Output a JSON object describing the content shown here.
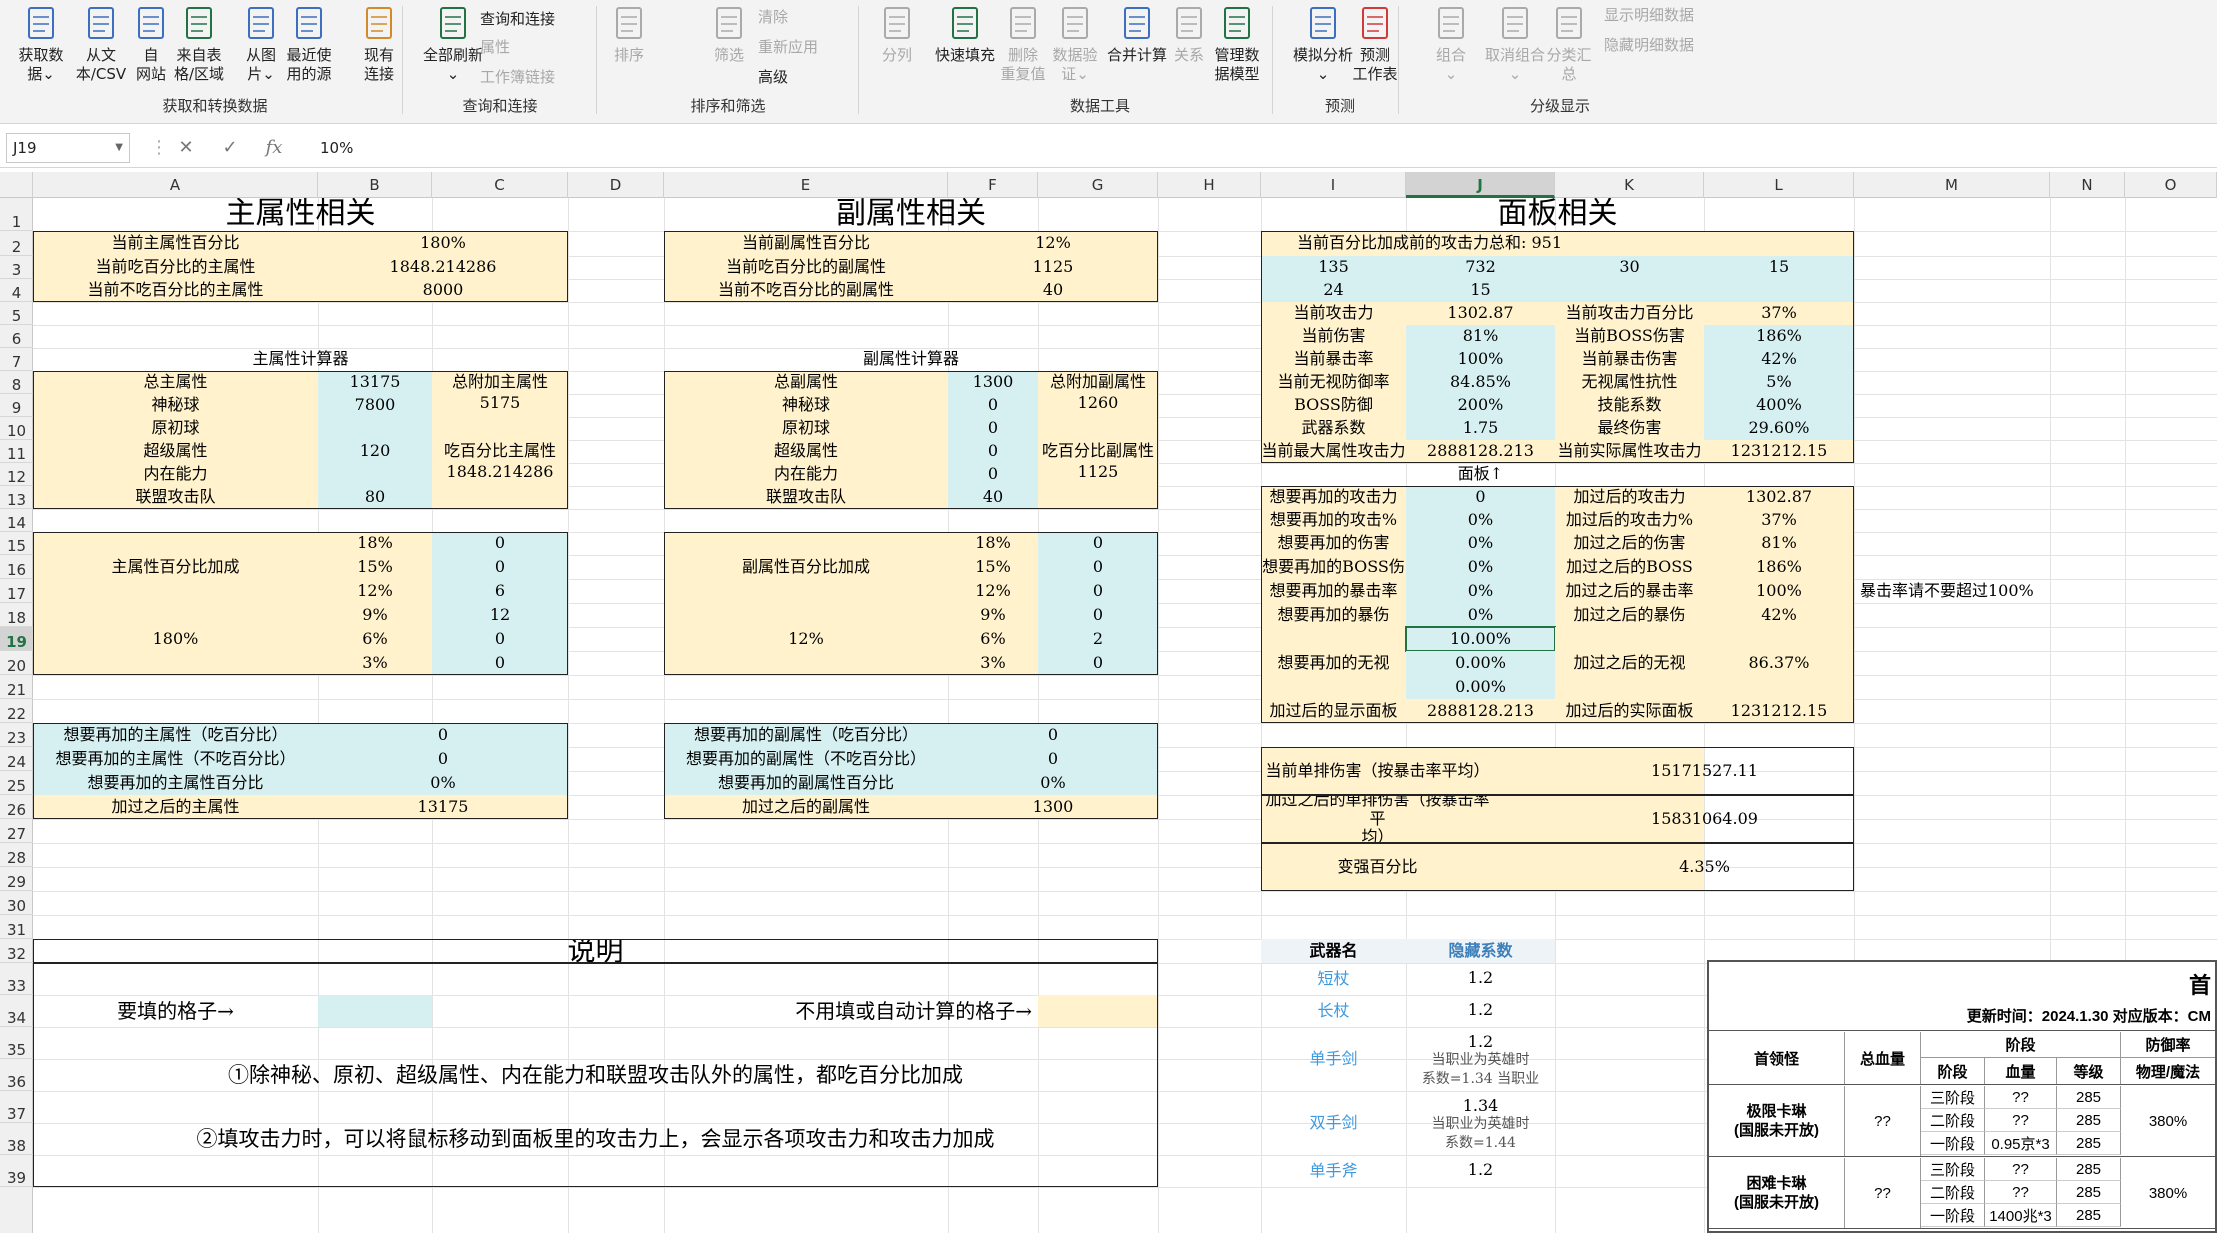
{
  "ribbon": {
    "buttons": [
      {
        "label": "获取数\n据⌄",
        "icon": "database-icon"
      },
      {
        "label": "从文\n本/CSV",
        "icon": "text-file-icon"
      },
      {
        "label": "自\n网站",
        "icon": "web-icon"
      },
      {
        "label": "来自表\n格/区域",
        "icon": "table-icon"
      },
      {
        "label": "从图\n片⌄",
        "icon": "picture-icon"
      },
      {
        "label": "最近使\n用的源",
        "icon": "recent-sources-icon"
      },
      {
        "label": "现有\n连接",
        "icon": "existing-connections-icon"
      },
      {
        "label": "全部刷新\n⌄",
        "icon": "refresh-all-icon"
      },
      {
        "label": "排序",
        "icon": "sort-icon"
      },
      {
        "label": "筛选",
        "icon": "filter-icon"
      },
      {
        "label": "分列",
        "icon": "text-to-columns-icon"
      },
      {
        "label": "快速填充",
        "icon": "flash-fill-icon"
      },
      {
        "label": "删除\n重复值",
        "icon": "remove-duplicates-icon"
      },
      {
        "label": "数据验\n证⌄",
        "icon": "data-validation-icon"
      },
      {
        "label": "合并计算",
        "icon": "consolidate-icon"
      },
      {
        "label": "关系",
        "icon": "relationships-icon"
      },
      {
        "label": "管理数\n据模型",
        "icon": "data-model-icon"
      },
      {
        "label": "模拟分析\n⌄",
        "icon": "what-if-icon"
      },
      {
        "label": "预测\n工作表",
        "icon": "forecast-sheet-icon"
      },
      {
        "label": "组合\n⌄",
        "icon": "group-icon"
      },
      {
        "label": "取消组合\n⌄",
        "icon": "ungroup-icon"
      },
      {
        "label": "分类汇总",
        "icon": "subtotal-icon"
      }
    ],
    "small": {
      "queries": "查询和连接",
      "properties": "属性",
      "edit_links": "工作簿链接",
      "clear": "清除",
      "reapply": "重新应用",
      "advanced": "高级",
      "show_detail": "显示明细数据",
      "hide_detail": "隐藏明细数据"
    },
    "groups": {
      "get_transform": "获取和转换数据",
      "queries": "查询和连接",
      "sort_filter": "排序和筛选",
      "data_tools": "数据工具",
      "forecast": "预测",
      "outline": "分级显示"
    }
  },
  "formula_bar": {
    "name_box": "J19",
    "content": "10%",
    "cancel": "✕",
    "enter": "✓",
    "fx": "fx"
  },
  "columns": [
    "A",
    "B",
    "C",
    "D",
    "E",
    "F",
    "G",
    "H",
    "I",
    "J",
    "K",
    "L",
    "M",
    "N",
    "O"
  ],
  "rows": [
    "1",
    "2",
    "3",
    "4",
    "5",
    "6",
    "7",
    "8",
    "9",
    "10",
    "11",
    "12",
    "13",
    "14",
    "15",
    "16",
    "17",
    "18",
    "19",
    "20",
    "21",
    "22",
    "23",
    "24",
    "25",
    "26",
    "27",
    "28",
    "29",
    "30",
    "31",
    "32",
    "33",
    "34",
    "35",
    "36",
    "37",
    "38",
    "39"
  ],
  "sheet": {
    "main": {
      "title": "主属性相关",
      "pct_label": "当前主属性百分比",
      "pct_value": "180%",
      "eat_label": "当前吃百分比的主属性",
      "eat_value": "1848.214286",
      "noeat_label": "当前不吃百分比的主属性",
      "noeat_value": "8000",
      "calc_title": "主属性计算器",
      "total_label": "总主属性",
      "total_value": "13175",
      "added_label": "总附加主属性",
      "mystic_label": "神秘球",
      "mystic_value": "7800",
      "added_value": "5175",
      "origin_label": "原初球",
      "origin_value": "",
      "super_label": "超级属性",
      "super_value": "120",
      "eatpct_label": "吃百分比主属性",
      "inner_label": "内在能力",
      "inner_value": "",
      "eatpct_value": "1848.214286",
      "union_label": "联盟攻击队",
      "union_value": "80",
      "bonus_label": "主属性百分比加成",
      "bonus_total": "180%",
      "bonus_pcts": [
        "18%",
        "15%",
        "12%",
        "9%",
        "6%",
        "3%"
      ],
      "bonus_counts": [
        "0",
        "0",
        "6",
        "12",
        "0",
        "0"
      ],
      "want_eat_label": "想要再加的主属性（吃百分比）",
      "want_eat_value": "0",
      "want_noeat_label": "想要再加的主属性（不吃百分比）",
      "want_noeat_value": "0",
      "want_pct_label": "想要再加的主属性百分比",
      "want_pct_value": "0%",
      "after_label": "加过之后的主属性",
      "after_value": "13175"
    },
    "sub": {
      "title": "副属性相关",
      "pct_label": "当前副属性百分比",
      "pct_value": "12%",
      "eat_label": "当前吃百分比的副属性",
      "eat_value": "1125",
      "noeat_label": "当前不吃百分比的副属性",
      "noeat_value": "40",
      "calc_title": "副属性计算器",
      "total_label": "总副属性",
      "total_value": "1300",
      "added_label": "总附加副属性",
      "mystic_label": "神秘球",
      "mystic_value": "0",
      "added_value": "1260",
      "origin_label": "原初球",
      "origin_value": "0",
      "super_label": "超级属性",
      "super_value": "0",
      "eatpct_label": "吃百分比副属性",
      "inner_label": "内在能力",
      "inner_value": "0",
      "eatpct_value": "1125",
      "union_label": "联盟攻击队",
      "union_value": "40",
      "bonus_label": "副属性百分比加成",
      "bonus_total": "12%",
      "bonus_pcts": [
        "18%",
        "15%",
        "12%",
        "9%",
        "6%",
        "3%"
      ],
      "bonus_counts": [
        "0",
        "0",
        "0",
        "0",
        "2",
        "0"
      ],
      "want_eat_label": "想要再加的副属性（吃百分比）",
      "want_eat_value": "0",
      "want_noeat_label": "想要再加的副属性（不吃百分比）",
      "want_noeat_value": "0",
      "want_pct_label": "想要再加的副属性百分比",
      "want_pct_value": "0%",
      "after_label": "加过之后的副属性",
      "after_value": "1300"
    },
    "panel": {
      "title": "面板相关",
      "atk_sum_label": "当前百分比加成前的攻击力总和: 951",
      "r3": [
        "135",
        "732",
        "30",
        "15"
      ],
      "r4": [
        "24",
        "15"
      ],
      "atk_label": "当前攻击力",
      "atk_value": "1302.87",
      "atkpct_label": "当前攻击力百分比",
      "atkpct_value": "37%",
      "dmg_label": "当前伤害",
      "dmg_value": "81%",
      "boss_label": "当前BOSS伤害",
      "boss_value": "186%",
      "crit_label": "当前暴击率",
      "crit_value": "100%",
      "critdmg_label": "当前暴击伤害",
      "critdmg_value": "42%",
      "ied_label": "当前无视防御率",
      "ied_value": "84.85%",
      "ignres_label": "无视属性抗性",
      "ignres_value": "5%",
      "bossdef_label": "BOSS防御",
      "bossdef_value": "200%",
      "skill_label": "技能系数",
      "skill_value": "400%",
      "weapon_label": "武器系数",
      "weapon_value": "1.75",
      "final_label": "最终伤害",
      "final_value": "29.60%",
      "maxstat_label": "当前最大属性攻击力",
      "maxstat_value": "2888128.213",
      "realstat_label": "当前实际属性攻击力",
      "realstat_value": "1231212.15",
      "panel_arrow": "面板↑",
      "w_atk_label": "想要再加的攻击力",
      "w_atk_value": "0",
      "a_atk_label": "加过后的攻击力",
      "a_atk_value": "1302.87",
      "w_atkpct_label": "想要再加的攻击%",
      "w_atkpct_value": "0%",
      "a_atkpct_label": "加过后的攻击力%",
      "a_atkpct_value": "37%",
      "w_dmg_label": "想要再加的伤害",
      "w_dmg_value": "0%",
      "a_dmg_label": "加过之后的伤害",
      "a_dmg_value": "81%",
      "w_boss_label": "想要再加的BOSS伤",
      "w_boss_value": "0%",
      "a_boss_label": "加过之后的BOSS",
      "a_boss_value": "186%",
      "w_crit_label": "想要再加的暴击率",
      "w_crit_value": "0%",
      "a_crit_label": "加过之后的暴击率",
      "a_crit_value": "100%",
      "crit_note": "暴击率请不要超过100%",
      "w_critdmg_label": "想要再加的暴伤",
      "w_critdmg_value": "0%",
      "a_critdmg_label": "加过之后的暴伤",
      "a_critdmg_value": "42%",
      "w_ied_label": "想要再加的无视",
      "w_ied_values": [
        "10.00%",
        "0.00%",
        "0.00%"
      ],
      "a_ied_label": "加过之后的无视",
      "a_ied_value": "86.37%",
      "disp_label": "加过后的显示面板",
      "disp_value": "2888128.213",
      "real_label": "加过后的实际面板",
      "real_value": "1231212.15",
      "single_label": "当前单排伤害（按暴击率平均）",
      "single_value": "15171527.11",
      "after_single_label": "加过之后的单排伤害（按暴击率平\n均）",
      "after_single_value": "15831064.09",
      "gain_label": "变强百分比",
      "gain_value": "4.35%"
    },
    "notes": {
      "title": "说明",
      "fill_label": "要填的格子→",
      "auto_label": "不用填或自动计算的格子→",
      "n1": "①除神秘、原初、超级属性、内在能力和联盟攻击队外的属性，都吃百分比加成",
      "n2": "②填攻击力时，可以将鼠标移动到面板里的攻击力上，会显示各项攻击力和攻击力加成"
    },
    "weapons": {
      "h1": "武器名",
      "h2": "隐藏系数",
      "rows": [
        {
          "name": "短杖",
          "value": "1.2",
          "note": ""
        },
        {
          "name": "长杖",
          "value": "1.2",
          "note": ""
        },
        {
          "name": "单手剑",
          "value": "1.2",
          "note": "当职业为英雄时\n系数=1.34 当职业"
        },
        {
          "name": "双手剑",
          "value": "1.34",
          "note": "当职业为英雄时\n系数=1.44"
        },
        {
          "name": "单手斧",
          "value": "1.2",
          "note": ""
        }
      ]
    },
    "boss_table": {
      "title": "首",
      "update": "更新时间：2024.1.30  对应版本：CM",
      "h_boss": "首领怪",
      "h_hp": "总血量",
      "h_stage": "阶段",
      "h_def": "防御率",
      "sub_stage": "阶段",
      "sub_hp": "血量",
      "sub_lvl": "等级",
      "sub_def": "物理/魔法",
      "groups": [
        {
          "name": "极限卡琳\n(国服未开放)",
          "hp": "??",
          "def": "380%",
          "rows": [
            [
              "三阶段",
              "??",
              "285"
            ],
            [
              "二阶段",
              "??",
              "285"
            ],
            [
              "一阶段",
              "0.95京*3",
              "285"
            ]
          ]
        },
        {
          "name": "困难卡琳\n(国服未开放)",
          "hp": "??",
          "def": "380%",
          "rows": [
            [
              "三阶段",
              "??",
              "285"
            ],
            [
              "二阶段",
              "??",
              "285"
            ],
            [
              "一阶段",
              "1400兆*3",
              "285"
            ]
          ]
        }
      ]
    }
  }
}
